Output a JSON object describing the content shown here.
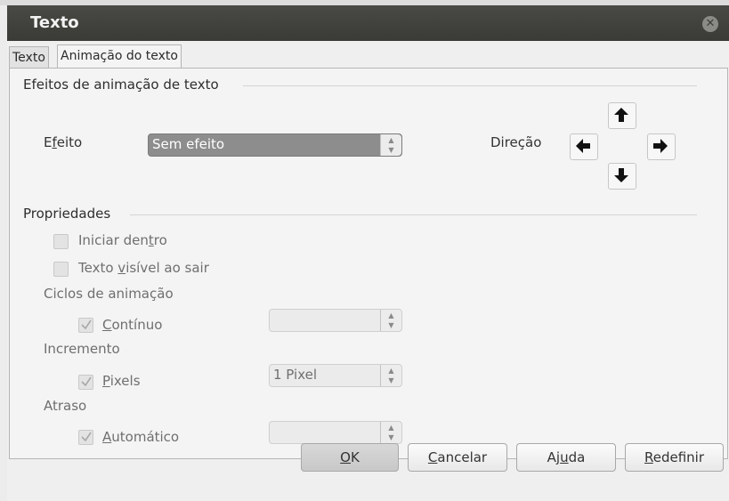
{
  "window": {
    "title": "Texto",
    "close_icon": "close-circle-icon"
  },
  "tabs": [
    {
      "label": "Texto",
      "active": false
    },
    {
      "label": "Animação do texto",
      "active": true
    }
  ],
  "effects_group": {
    "header": "Efeitos de animação de texto",
    "effect_label_pre": "E",
    "effect_label_u": "f",
    "effect_label_post": "eito",
    "effect_value": "Sem efeito",
    "direction_label": "Direção"
  },
  "properties_group": {
    "header": "Propriedades",
    "start_inside": {
      "pre": "Iniciar den",
      "u": "t",
      "post": "ro",
      "checked": false,
      "enabled": false
    },
    "visible_on_exit": {
      "pre": "Texto ",
      "u": "v",
      "post": "isível ao sair",
      "checked": false,
      "enabled": false
    },
    "cycles_label": "Ciclos de animação",
    "continuous": {
      "u": "C",
      "post": "ontínuo",
      "checked": true,
      "enabled": false,
      "value": ""
    },
    "increment_label": "Incremento",
    "pixels": {
      "u": "P",
      "post": "ixels",
      "checked": true,
      "enabled": false,
      "value": "1 Pixel"
    },
    "delay_label": "Atraso",
    "automatic": {
      "u": "A",
      "post": "utomático",
      "checked": true,
      "enabled": false,
      "value": ""
    }
  },
  "buttons": {
    "ok": {
      "u": "O",
      "post": "K"
    },
    "cancel": {
      "u": "C",
      "post": "ancelar"
    },
    "help": {
      "pre": "Aj",
      "u": "u",
      "post": "da"
    },
    "reset": {
      "u": "R",
      "post": "edefinir"
    }
  }
}
